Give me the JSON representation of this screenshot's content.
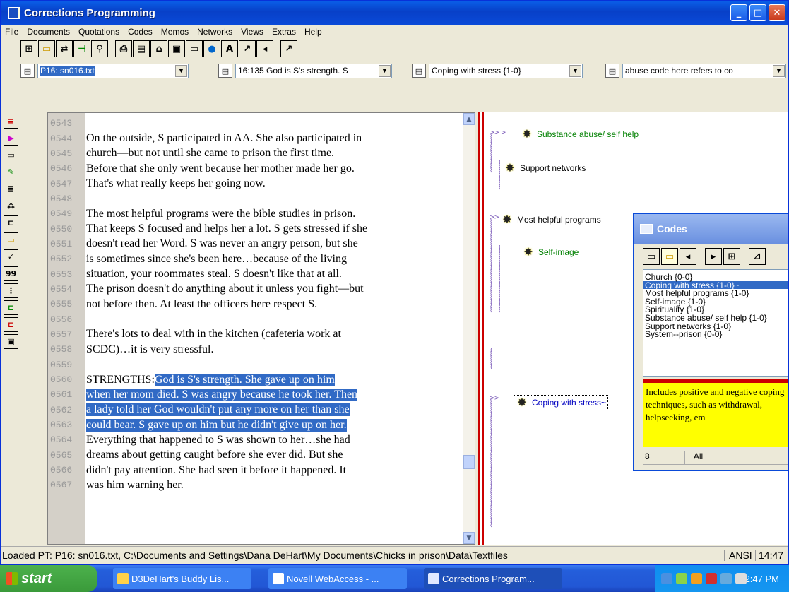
{
  "window": {
    "title": "Corrections Programming"
  },
  "menu": [
    "File",
    "Documents",
    "Quotations",
    "Codes",
    "Memos",
    "Networks",
    "Views",
    "Extras",
    "Help"
  ],
  "combos": {
    "document": "P16: sn016.txt",
    "quotation": "16:135 God is S's strength. S",
    "code": "Coping with stress {1-0}",
    "memo": "abuse code here refers to co"
  },
  "left_toolbar": {
    "count_label": "99"
  },
  "editor": {
    "lines": [
      {
        "n": "0543",
        "t": ""
      },
      {
        "n": "0544",
        "t": "On the outside, S participated in AA.  She also participated in"
      },
      {
        "n": "0545",
        "t": "church—but not until she came to prison the first time."
      },
      {
        "n": "0546",
        "t": "Before that she only went because her mother made her go."
      },
      {
        "n": "0547",
        "t": "That's what really keeps her going now."
      },
      {
        "n": "0548",
        "t": ""
      },
      {
        "n": "0549",
        "t": "The most helpful programs were the bible studies in prison."
      },
      {
        "n": "0550",
        "t": "That keeps S focused and helps her a lot.  S gets stressed if she"
      },
      {
        "n": "0551",
        "t": "doesn't read her Word.  S was never an angry person, but she"
      },
      {
        "n": "0552",
        "t": "is sometimes since she's been here…because of the living"
      },
      {
        "n": "0553",
        "t": "situation, your roommates steal.  S doesn't like that at all."
      },
      {
        "n": "0554",
        "t": "The prison doesn't do anything about it unless you fight—but"
      },
      {
        "n": "0555",
        "t": "not before then.  At least the officers here respect S."
      },
      {
        "n": "0556",
        "t": ""
      },
      {
        "n": "0557",
        "t": "There's lots to deal with in the kitchen (cafeteria work at"
      },
      {
        "n": "0558",
        "t": "SCDC)…it is very stressful."
      },
      {
        "n": "0559",
        "t": ""
      },
      {
        "n": "0560",
        "t": "STRENGTHS: ",
        "h": "God is S's strength.  She gave up on him"
      },
      {
        "n": "0561",
        "t": "",
        "h": "when her mom died.  S was angry because he took her.  Then"
      },
      {
        "n": "0562",
        "t": "",
        "h": "a lady told her God wouldn't put any more on her than she"
      },
      {
        "n": "0563",
        "t": "",
        "h": "could bear.  S gave up on him but he didn't give up on her."
      },
      {
        "n": "0564",
        "t": "Everything that happened to S was shown to her…she had"
      },
      {
        "n": "0565",
        "t": "dreams about getting caught before she ever did.  But she"
      },
      {
        "n": "0566",
        "t": "didn't pay attention.  She had seen it before it happened.  It"
      },
      {
        "n": "0567",
        "t": "was him warning her."
      }
    ]
  },
  "margin_codes": [
    {
      "label": "Substance abuse/ self help",
      "color": "#008000"
    },
    {
      "label": "Support networks",
      "color": "#000000"
    },
    {
      "label": "Most helpful programs",
      "color": "#000000"
    },
    {
      "label": "Self-image",
      "color": "#008000"
    },
    {
      "label": "Coping with stress~",
      "color": "#0000c0"
    }
  ],
  "codes_dialog": {
    "title": "Codes",
    "items": [
      "Church {0-0}",
      "Coping with stress {1-0}~",
      "Most helpful programs {1-0}",
      "Self-image {1-0}",
      "Spirituality {1-0}",
      "Substance abuse/ self help {1-0}",
      "Support networks {1-0}",
      "System--prison {0-0}"
    ],
    "selected_index": 1,
    "memo": "Includes positive and negative coping techniques, such as withdrawal, helpseeking, em",
    "count": "8",
    "filter": "All"
  },
  "status": {
    "text": "Loaded PT: P16: sn016.txt, C:\\Documents and Settings\\Dana DeHart\\My Documents\\Chicks in prison\\Data\\Textfiles",
    "encoding": "ANSI",
    "time": "14:47"
  },
  "taskbar": {
    "start": "start",
    "tasks": [
      "D3DeHart's Buddy Lis...",
      "Novell WebAccess - ...",
      "Corrections Program..."
    ],
    "clock": "2:47 PM"
  }
}
